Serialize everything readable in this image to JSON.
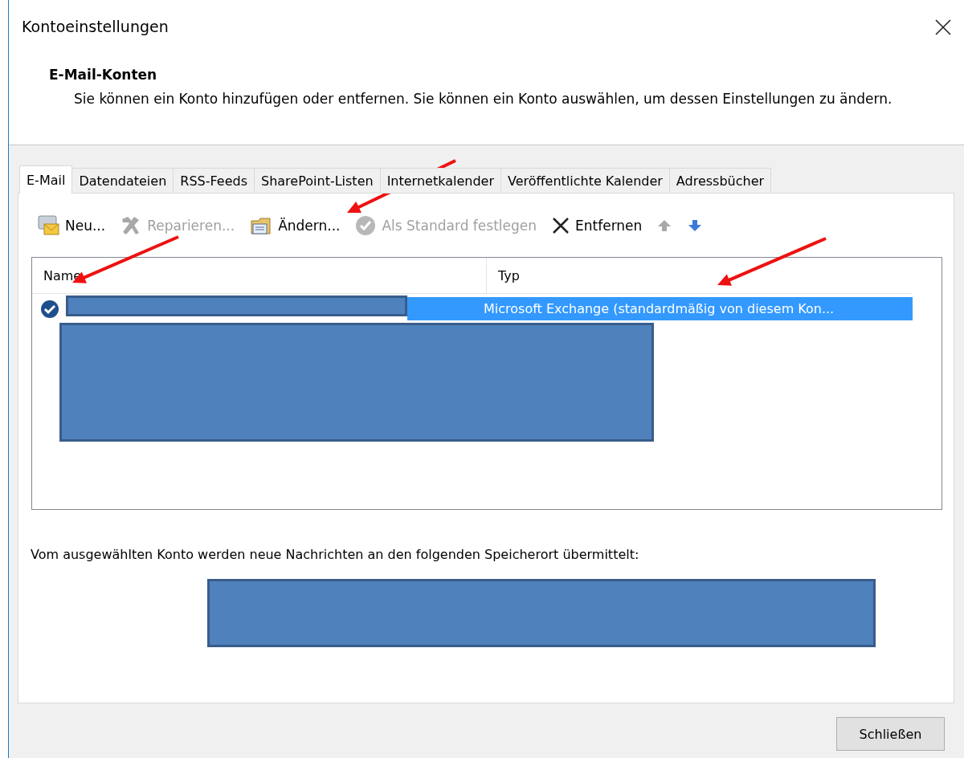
{
  "window": {
    "title": "Kontoeinstellungen"
  },
  "header": {
    "title": "E-Mail-Konten",
    "description": "Sie können ein Konto hinzufügen oder entfernen. Sie können ein Konto auswählen, um dessen Einstellungen zu ändern."
  },
  "tabs": [
    {
      "label": "E-Mail",
      "selected": true
    },
    {
      "label": "Datendateien",
      "selected": false
    },
    {
      "label": "RSS-Feeds",
      "selected": false
    },
    {
      "label": "SharePoint-Listen",
      "selected": false
    },
    {
      "label": "Internetkalender",
      "selected": false
    },
    {
      "label": "Veröffentlichte Kalender",
      "selected": false
    },
    {
      "label": "Adressbücher",
      "selected": false
    }
  ],
  "toolbar": [
    {
      "kind": "new",
      "label": "Neu...",
      "disabled": false
    },
    {
      "kind": "repair",
      "label": "Reparieren...",
      "disabled": true
    },
    {
      "kind": "change",
      "label": "Ändern...",
      "disabled": false
    },
    {
      "kind": "default",
      "label": "Als Standard festlegen",
      "disabled": true
    },
    {
      "kind": "remove",
      "label": "Entfernen",
      "disabled": false
    },
    {
      "kind": "up",
      "disabled": true
    },
    {
      "kind": "down",
      "disabled": false
    }
  ],
  "accounts": {
    "columns": [
      "Name",
      "Typ"
    ],
    "rows": [
      {
        "type": "Microsoft Exchange (standardmäßig von diesem Kon...",
        "selected": true,
        "default": true
      }
    ]
  },
  "delivery_text": "Vom ausgewählten Konto werden neue Nachrichten an den folgenden Speicherort übermittelt:",
  "close_button": "Schließen"
}
